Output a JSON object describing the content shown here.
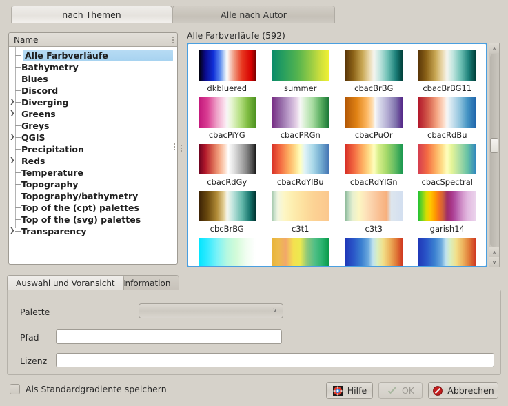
{
  "window": {
    "background": "#d6d2ca"
  },
  "top_tabs": [
    {
      "label": "nach Themen",
      "selected": true
    },
    {
      "label": "Alle nach Autor",
      "selected": false
    }
  ],
  "tree": {
    "header": "Name",
    "items": [
      {
        "label": "Alle Farbverläufe",
        "expandable": false,
        "selected": true
      },
      {
        "label": "Bathymetry",
        "expandable": false,
        "selected": false
      },
      {
        "label": "Blues",
        "expandable": false,
        "selected": false
      },
      {
        "label": "Discord",
        "expandable": false,
        "selected": false
      },
      {
        "label": "Diverging",
        "expandable": true,
        "selected": false
      },
      {
        "label": "Greens",
        "expandable": true,
        "selected": false
      },
      {
        "label": "Greys",
        "expandable": false,
        "selected": false
      },
      {
        "label": "QGIS",
        "expandable": true,
        "selected": false
      },
      {
        "label": "Precipitation",
        "expandable": false,
        "selected": false
      },
      {
        "label": "Reds",
        "expandable": true,
        "selected": false
      },
      {
        "label": "Temperature",
        "expandable": false,
        "selected": false
      },
      {
        "label": "Topography",
        "expandable": false,
        "selected": false
      },
      {
        "label": "Topography/bathymetry",
        "expandable": false,
        "selected": false
      },
      {
        "label": "Top of the (cpt) palettes",
        "expandable": false,
        "selected": false
      },
      {
        "label": "Top of the (svg) palettes",
        "expandable": false,
        "selected": false
      },
      {
        "label": "Transparency",
        "expandable": true,
        "selected": false
      }
    ],
    "selection_color": "#a6d2f0"
  },
  "gallery": {
    "title": "Alle Farbverläufe (592)",
    "count": 592,
    "focus_border_color": "#4a9fe0",
    "items": [
      {
        "label": "dkbluered",
        "stops": "#000000 0%, #0b0b8c 12%, #1030d8 26%, #5f8df0 38%, #cfe0f7 46%, #ffffff 50%, #f7d8d0 54%, #f09a80 62%, #e83820 76%, #d60000 92%, #7a0000 100%"
      },
      {
        "label": "summer",
        "stops": "#0a8a6a 0%, #2aa05e 22%, #55b44e 46%, #95cb45 68%, #cfe03c 86%, #eef034 100%"
      },
      {
        "label": "cbacBrBG",
        "stops": "#5a3608 0%, #8c6318 14%, #c9a855 30%, #ead9ae 42%, #f5f5f0 50%, #c3e6e0 60%, #6fc0b5 74%, #1c8079 88%, #00403a 100%"
      },
      {
        "label": "cbacBrBG11",
        "stops": "#5a3608 0%, #8c6318 14%, #c9a855 30%, #ead9ae 42%, #f5f5f0 50%, #c3e6e0 60%, #6fc0b5 74%, #1c8079 88%, #00403a 100%"
      },
      {
        "label": "cbacPiYG",
        "stops": "#c2167a 0%, #da3f94 16%, #eea2c8 32%, #fbe3ef 46%, #f7f7f7 50%, #e6f5d0 58%, #b8e186 72%, #7fbc41 86%, #4d9221 100%"
      },
      {
        "label": "cbacPRGn",
        "stops": "#762a83 0%, #9970ab 18%, #c2a5cf 32%, #e7d4e8 44%, #f7f7f7 50%, #d9f0d3 58%, #a6dba0 72%, #5aae61 86%, #1b7837 100%"
      },
      {
        "label": "cbacPuOr",
        "stops": "#b35806 0%, #e08214 20%, #fdb863 38%, #fee0b6 48%, #f7f7f7 52%, #d8daeb 60%, #b2abd2 74%, #8073ac 88%, #542788 100%"
      },
      {
        "label": "cbacRdBu",
        "stops": "#b2182b 0%, #d6604d 18%, #f4a582 32%, #fddbc7 44%, #f7f7f7 50%, #d1e5f0 58%, #92c5de 72%, #4393c3 86%, #2166ac 100%"
      },
      {
        "label": "cbacRdGy",
        "stops": "#67001f 0%, #b2182b 12%, #d6604d 24%, #f4a582 36%, #fddbc7 46%, #ffffff 52%, #e0e0e0 62%, #bababa 72%, #878787 84%, #4d4d4d 94%, #1a1a1a 100%"
      },
      {
        "label": "cbacRdYlBu",
        "stops": "#d73027 0%, #f46d43 16%, #fdae61 30%, #fee090 42%, #ffffbf 50%, #e0f3f8 58%, #abd9e9 72%, #74add1 86%, #4575b4 100%"
      },
      {
        "label": "cbacRdYlGn",
        "stops": "#d73027 0%, #f46d43 16%, #fdae61 30%, #fee08b 42%, #ffffbf 50%, #d9ef8b 58%, #a6d96a 72%, #66bd63 86%, #1a9850 100%"
      },
      {
        "label": "cbacSpectral",
        "stops": "#d53e4f 0%, #f46d43 16%, #fdae61 30%, #fee08b 42%, #ffffbf 50%, #e6f598 58%, #abdda4 72%, #66c2a5 86%, #3288bd 100%"
      },
      {
        "label": "cbcBrBG",
        "stops": "#3a2005 0%, #6b4a0e 16%, #b08a36 32%, #e3cf96 44%, #f7f7ef 50%, #bfe4dd 60%, #64b8ab 76%, #15736b 90%, #003330 100%"
      },
      {
        "label": "c3t1",
        "stops": "#9dc3a5 0%, #c9e0cb 5%, #f2f6e2 11%, #fdf6c5 22%, #fdeeb0 36%, #fde1a0 54%, #fcd294 74%, #fbc88e 100%"
      },
      {
        "label": "c3t3",
        "stops": "#8fbb9b 0%, #bcd9bf 6%, #e8f0cf 13%, #fcf6c2 24%, #fde2ba 36%, #fbcfa8 48%, #f9bc8e 62%, #f7b07e 72%, #dde6ee 80%, #d3dff0 100%"
      },
      {
        "label": "garish14",
        "stops": "#22c233 0%, #7ad420 7%, #d8dd00 14%, #ffc800 21%, #ff9a00 29%, #f4701f 36%, #cc5f3c 43%, #9e2d68 50%, #a8368a 58%, #b455a6 65%, #c67bbd 72%, #d79ed0 79%, #e2b9e0 86%, #ebd3ec 100%"
      },
      {
        "label": "",
        "stops": "#00e5ff 0%, #34eaff 16%, #7cf2f7 33%, #b6f8e0 50%, #d3fbd8 66%, #f0fdf0 83%, #ffffff 100%"
      },
      {
        "label": "",
        "stops": "#e8b33a 0%, #edbb4c 12%, #f2a86a 25%, #f4e04f 38%, #ece94f 50%, #8fc87a 62%, #52bf86 75%, #2ab36f 88%, #0a9b4a 100%"
      },
      {
        "label": "",
        "stops": "#2038b8 0%, #2a56c8 14%, #3a7fd0 28%, #6aa8dd 40%, #bfe2ee 48%, #d9eec0 56%, #f2e08a 66%, #edb15c 78%, #e07a38 89%, #cf3820 100%"
      },
      {
        "label": "",
        "stops": "#2038b8 0%, #2a56c8 14%, #3a7fd0 28%, #6aa8dd 40%, #bfe2ee 48%, #d9eec0 56%, #f2e08a 66%, #edb15c 78%, #e07a38 89%, #cf3820 100%"
      }
    ],
    "scrollbar": {
      "up_arrow": "∧",
      "down_arrow": "∨"
    }
  },
  "lower_tabs": [
    {
      "label": "Auswahl und Voransicht",
      "selected": true
    },
    {
      "label": "Information",
      "selected": false
    }
  ],
  "form": {
    "palette_label": "Palette",
    "palette_value": "",
    "palette_chevron": "∨",
    "path_label": "Pfad",
    "path_value": "",
    "license_label": "Lizenz",
    "license_value": ""
  },
  "footer": {
    "checkbox_label": "Als Standardgradiente speichern",
    "checkbox_checked": false,
    "buttons": [
      {
        "label": "Hilfe",
        "icon": "help-lifebuoy-icon",
        "enabled": true
      },
      {
        "label": "OK",
        "icon": "check-icon",
        "enabled": false
      },
      {
        "label": "Abbrechen",
        "icon": "cancel-icon",
        "enabled": true
      }
    ]
  }
}
